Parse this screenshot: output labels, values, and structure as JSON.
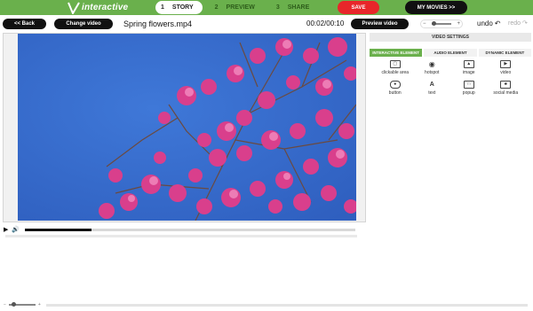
{
  "app": {
    "logo_text": "interactive",
    "brand_color": "#6ab04c"
  },
  "steps": [
    {
      "number": "1",
      "label": "STORY",
      "active": true
    },
    {
      "number": "2",
      "label": "PREVIEW",
      "active": false
    },
    {
      "number": "3",
      "label": "SHARE",
      "active": false
    }
  ],
  "header": {
    "save_label": "SAVE",
    "my_movies_label": "MY MOVIES >>",
    "save_color": "#e8262a"
  },
  "toolbar": {
    "back_label": "<< Back",
    "change_video_label": "Change video",
    "filename": "Spring flowers.mp4",
    "timecode": "00:02/00:10",
    "preview_label": "Preview video",
    "undo_label": "undo",
    "redo_label": "redo"
  },
  "player": {
    "progress_fraction": 0.2
  },
  "panel": {
    "title": "VIDEO SETTINGS",
    "tabs": [
      {
        "label": "INTERACTIVE ELEMENT",
        "active": true
      },
      {
        "label": "AUDIO ELEMENT",
        "active": false
      },
      {
        "label": "DYNAMIC ELEMENT",
        "active": false
      }
    ],
    "elements": [
      {
        "label": "clickable area",
        "icon": "clickable-area-icon"
      },
      {
        "label": "hotspot",
        "icon": "hotspot-icon"
      },
      {
        "label": "image",
        "icon": "image-icon"
      },
      {
        "label": "video",
        "icon": "video-icon"
      },
      {
        "label": "button",
        "icon": "button-icon"
      },
      {
        "label": "text",
        "icon": "text-icon"
      },
      {
        "label": "popup",
        "icon": "popup-icon"
      },
      {
        "label": "social media",
        "icon": "social-media-icon"
      }
    ]
  }
}
